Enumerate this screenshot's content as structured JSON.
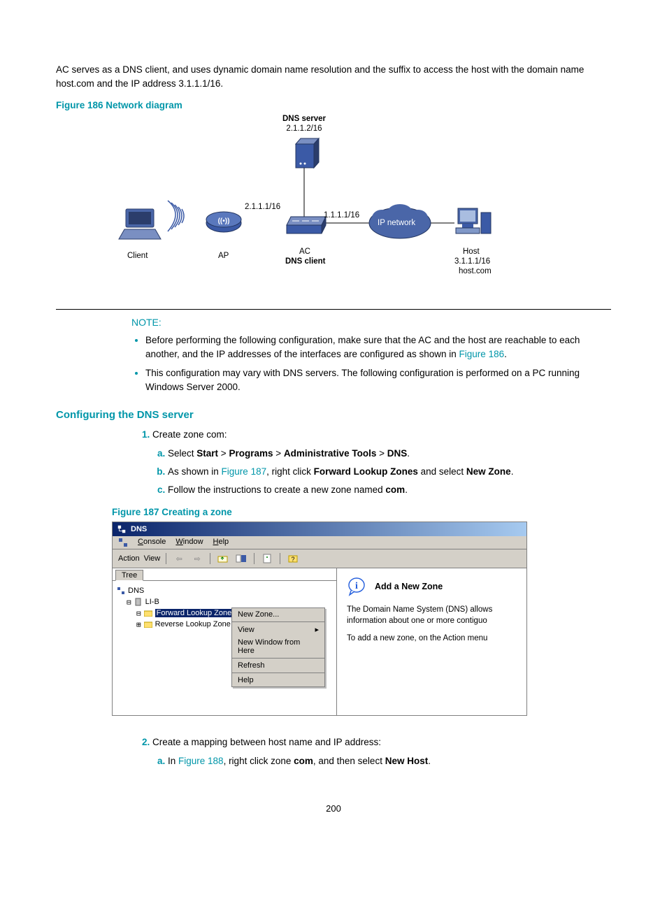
{
  "intro": "AC serves as a DNS client, and uses dynamic domain name resolution and the suffix to access the host with the domain name host.com and the IP address 3.1.1.1/16.",
  "fig186": {
    "title": "Figure 186 Network diagram",
    "dns_server": "DNS server",
    "dns_server_ip": "2.1.1.2/16",
    "ac_ip_left": "2.1.1.1/16",
    "ac_ip_right": "1.1.1.1/16",
    "ip_network": "IP network",
    "client": "Client",
    "ap": "AP",
    "ac": "AC",
    "dns_client": "DNS client",
    "host": "Host",
    "host_ip": "3.1.1.1/16",
    "host_name": "host.com"
  },
  "note": {
    "label": "NOTE:",
    "bullet1_pre": "Before performing the following configuration, make sure that the AC and the host are reachable to each another, and the IP addresses of the interfaces are configured as shown in ",
    "bullet1_link": "Figure 186",
    "bullet1_post": ".",
    "bullet2": "This configuration may vary with DNS servers. The following configuration is performed on a PC running Windows Server 2000."
  },
  "section_heading": "Configuring the DNS server",
  "step1": {
    "text": "Create zone com:",
    "a_pre": "Select ",
    "a_start": "Start",
    "a_gt1": " > ",
    "a_programs": "Programs",
    "a_gt2": " > ",
    "a_admin": "Administrative Tools",
    "a_gt3": " > ",
    "a_dns": "DNS",
    "a_post": ".",
    "b_pre": "As shown in ",
    "b_link": "Figure 187",
    "b_mid": ", right click ",
    "b_fwd": "Forward Lookup Zones",
    "b_and": " and select ",
    "b_new": "New Zone",
    "b_post": ".",
    "c_pre": "Follow the instructions to create a new zone named ",
    "c_com": "com",
    "c_post": "."
  },
  "fig187": {
    "title": "Figure 187 Creating a zone",
    "window_title": "DNS",
    "menu": {
      "console": "Console",
      "window": "Window",
      "help": "Help"
    },
    "toolbar": {
      "action": "Action",
      "view": "View"
    },
    "tree_tab": "Tree",
    "tree": {
      "root": "DNS",
      "host": "LI-B",
      "fwd": "Forward Lookup Zones",
      "rev": "Reverse Lookup Zone"
    },
    "context": {
      "new_zone": "New Zone...",
      "view": "View",
      "new_window": "New Window from Here",
      "refresh": "Refresh",
      "help": "Help"
    },
    "right": {
      "title": "Add a New Zone",
      "p1": "The Domain Name System (DNS) allows information about one or more contiguo",
      "p2": "To add a new zone, on the Action menu"
    }
  },
  "step2": {
    "text": "Create a mapping between host name and IP address:",
    "a_pre": "In ",
    "a_link": "Figure 188",
    "a_mid": ", right click zone ",
    "a_com": "com",
    "a_and": ", and then select ",
    "a_newhost": "New Host",
    "a_post": "."
  },
  "page_number": "200"
}
